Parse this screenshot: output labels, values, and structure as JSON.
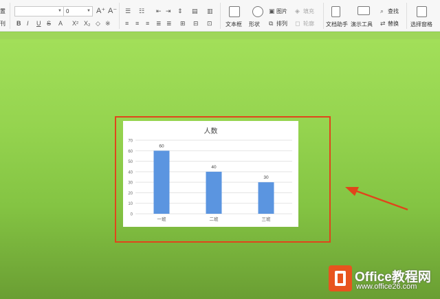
{
  "ribbon": {
    "partial_left_top": "置",
    "partial_left_bottom": "刊",
    "font_name_value": "",
    "font_size_value": "0",
    "text_box_label": "文本框",
    "shape_label": "形状",
    "picture_label": "图片",
    "fill_label": "填充",
    "arrange_label": "排列",
    "outline_label": "轮廓",
    "doc_assistant_label": "文档助手",
    "present_tools_label": "演示工具",
    "find_label": "查找",
    "replace_label": "替换",
    "selection_pane_label": "选择窗格"
  },
  "chart_data": {
    "type": "bar",
    "title": "人数",
    "categories": [
      "一班",
      "二班",
      "三班"
    ],
    "values": [
      60,
      40,
      30
    ],
    "data_labels": [
      "60",
      "40",
      "30"
    ],
    "yticks": [
      "0",
      "10",
      "20",
      "30",
      "40",
      "50",
      "60",
      "70"
    ],
    "ylim": [
      0,
      70
    ],
    "grid": true,
    "legend": "none",
    "bar_color": "#5b95e0"
  },
  "watermark": {
    "title": "Office教程网",
    "url": "www.office26.com"
  },
  "colors": {
    "highlight": "#e0451b",
    "arrow": "#e0451b"
  }
}
